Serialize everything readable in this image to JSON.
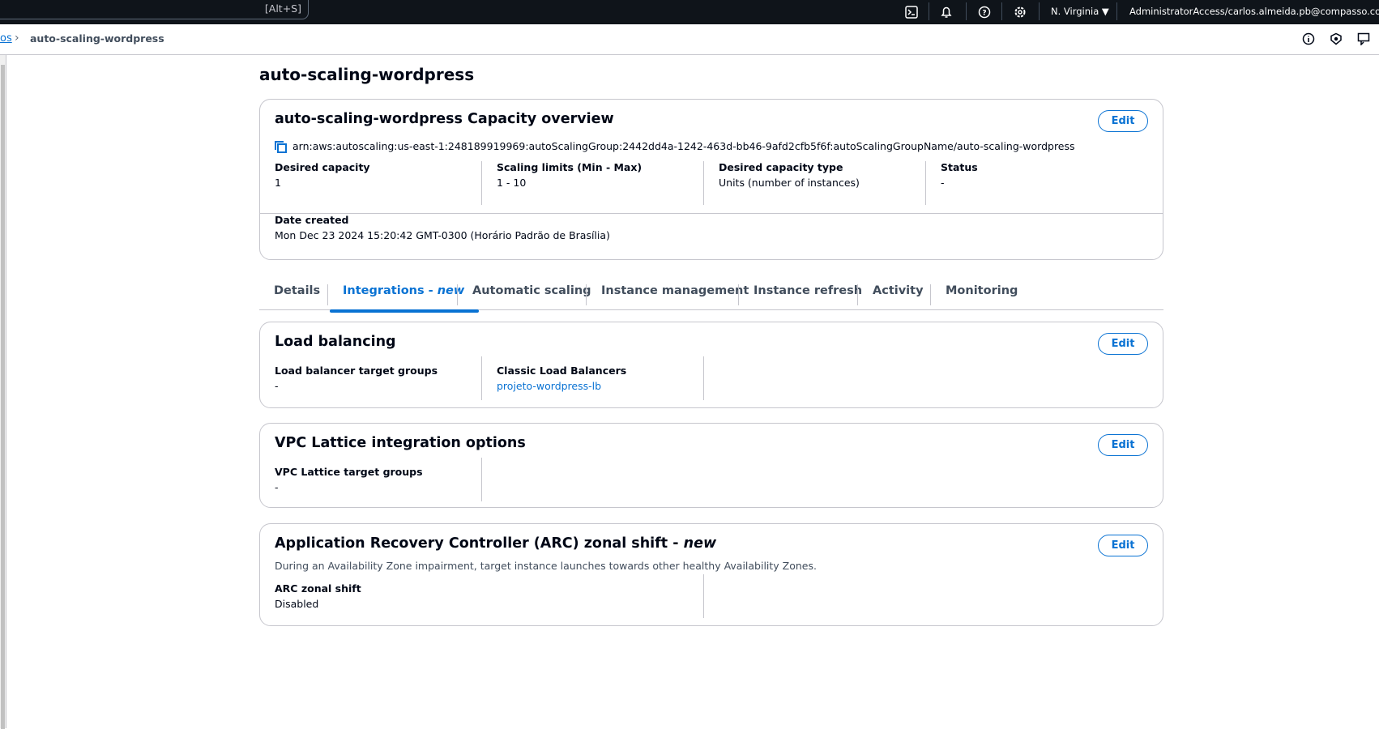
{
  "topbar": {
    "search_shortcut": "[Alt+S]",
    "region": "N. Virginia",
    "account": "AdministratorAccess/carlos.almeida.pb@compasso.com.br",
    "icons": [
      "cloudshell-icon",
      "bell-icon",
      "help-icon",
      "gear-icon"
    ]
  },
  "breadcrumb": {
    "parent": "os",
    "current": "auto-scaling-wordpress"
  },
  "page": {
    "title": "auto-scaling-wordpress"
  },
  "capacity": {
    "title": "auto-scaling-wordpress Capacity overview",
    "edit": "Edit",
    "arn": "arn:aws:autoscaling:us-east-1:248189919969:autoScalingGroup:2442dd4a-1242-463d-bb46-9afd2cfb5f6f:autoScalingGroupName/auto-scaling-wordpress",
    "fields": [
      {
        "label": "Desired capacity",
        "value": "1"
      },
      {
        "label": "Scaling limits (Min - Max)",
        "value": "1 - 10"
      },
      {
        "label": "Desired capacity type",
        "value": "Units (number of instances)"
      },
      {
        "label": "Status",
        "value": "-"
      }
    ],
    "date_label": "Date created",
    "date_value": "Mon Dec 23 2024 15:20:42 GMT-0300 (Horário Padrão de Brasília)"
  },
  "tabs": [
    {
      "label": "Details"
    },
    {
      "label": "Integrations - ",
      "em": "new",
      "active": true
    },
    {
      "label": "Automatic scaling"
    },
    {
      "label": "Instance management"
    },
    {
      "label": "Instance refresh"
    },
    {
      "label": "Activity"
    },
    {
      "label": "Monitoring"
    }
  ],
  "load_balancing": {
    "title": "Load balancing",
    "edit": "Edit",
    "tg_label": "Load balancer target groups",
    "tg_value": "-",
    "clb_label": "Classic Load Balancers",
    "clb_value": "projeto-wordpress-lb"
  },
  "vpc": {
    "title": "VPC Lattice integration options",
    "edit": "Edit",
    "tg_label": "VPC Lattice target groups",
    "tg_value": "-"
  },
  "arc": {
    "title": "Application Recovery Controller (ARC) zonal shift - ",
    "title_em": "new",
    "edit": "Edit",
    "description": "During an Availability Zone impairment, target instance launches towards other healthy Availability Zones.",
    "label": "ARC zonal shift",
    "value": "Disabled"
  },
  "colors": {
    "accent": "#0972d3",
    "topbar": "#0f141a",
    "border": "#c6c6cd"
  }
}
